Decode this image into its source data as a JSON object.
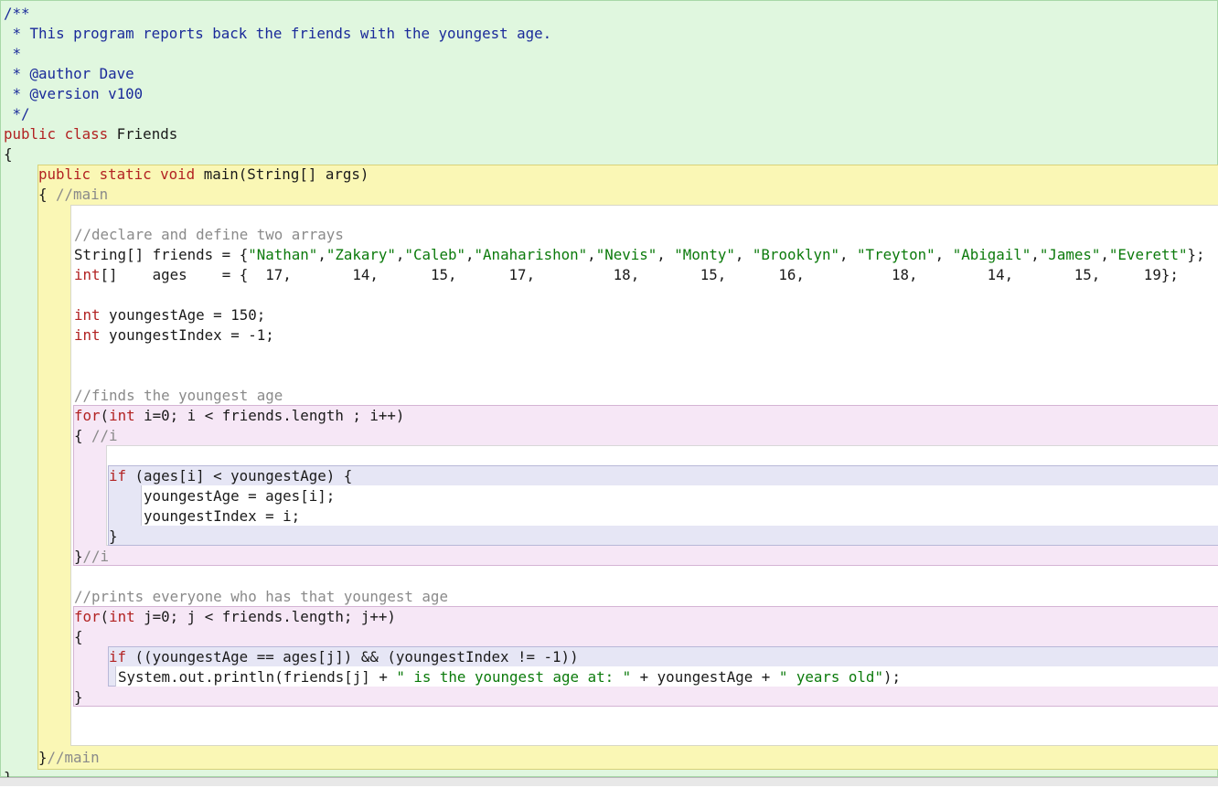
{
  "editor": {
    "lines": [
      {
        "id": "l01",
        "tokens": [
          {
            "t": "/**",
            "c": "jd"
          }
        ]
      },
      {
        "id": "l02",
        "tokens": [
          {
            "t": " * This program reports back the friends with the youngest age.",
            "c": "jd"
          }
        ]
      },
      {
        "id": "l03",
        "tokens": [
          {
            "t": " *",
            "c": "jd"
          }
        ]
      },
      {
        "id": "l04",
        "tokens": [
          {
            "t": " * @author Dave",
            "c": "jd"
          }
        ]
      },
      {
        "id": "l05",
        "tokens": [
          {
            "t": " * @version v100",
            "c": "jd"
          }
        ]
      },
      {
        "id": "l06",
        "tokens": [
          {
            "t": " */",
            "c": "jd"
          }
        ]
      },
      {
        "id": "l07",
        "tokens": [
          {
            "t": "public class",
            "c": "kw"
          },
          {
            "t": " Friends",
            "c": ""
          }
        ]
      },
      {
        "id": "l08",
        "tokens": [
          {
            "t": "{",
            "c": ""
          }
        ]
      },
      {
        "id": "l09",
        "tokens": [
          {
            "t": "public static void",
            "c": "kw"
          },
          {
            "t": " main(String[] args)",
            "c": ""
          }
        ]
      },
      {
        "id": "l10",
        "tokens": [
          {
            "t": "{ ",
            "c": ""
          },
          {
            "t": "//main",
            "c": "cm"
          }
        ]
      },
      {
        "id": "l11",
        "tokens": [
          {
            "t": "//declare and define two arrays",
            "c": "cm"
          }
        ]
      },
      {
        "id": "l12",
        "tokens": [
          {
            "t": "String[] friends = {",
            "c": ""
          },
          {
            "t": "\"Nathan\"",
            "c": "str"
          },
          {
            "t": ",",
            "c": ""
          },
          {
            "t": "\"Zakary\"",
            "c": "str"
          },
          {
            "t": ",",
            "c": ""
          },
          {
            "t": "\"Caleb\"",
            "c": "str"
          },
          {
            "t": ",",
            "c": ""
          },
          {
            "t": "\"Anaharishon\"",
            "c": "str"
          },
          {
            "t": ",",
            "c": ""
          },
          {
            "t": "\"Nevis\"",
            "c": "str"
          },
          {
            "t": ", ",
            "c": ""
          },
          {
            "t": "\"Monty\"",
            "c": "str"
          },
          {
            "t": ", ",
            "c": ""
          },
          {
            "t": "\"Brooklyn\"",
            "c": "str"
          },
          {
            "t": ", ",
            "c": ""
          },
          {
            "t": "\"Treyton\"",
            "c": "str"
          },
          {
            "t": ", ",
            "c": ""
          },
          {
            "t": "\"Abigail\"",
            "c": "str"
          },
          {
            "t": ",",
            "c": ""
          },
          {
            "t": "\"James\"",
            "c": "str"
          },
          {
            "t": ",",
            "c": ""
          },
          {
            "t": "\"Everett\"",
            "c": "str"
          },
          {
            "t": "};",
            "c": ""
          }
        ]
      },
      {
        "id": "l13",
        "tokens": [
          {
            "t": "int",
            "c": "kw"
          },
          {
            "t": "[]    ages    = {  17,       14,      15,      17,         18,       15,      16,          18,        14,       15,     19};",
            "c": ""
          }
        ]
      },
      {
        "id": "l14",
        "tokens": [
          {
            "t": "int",
            "c": "kw"
          },
          {
            "t": " youngestAge = 150;",
            "c": ""
          }
        ]
      },
      {
        "id": "l15",
        "tokens": [
          {
            "t": "int",
            "c": "kw"
          },
          {
            "t": " youngestIndex = -1;",
            "c": ""
          }
        ]
      },
      {
        "id": "l16",
        "tokens": [
          {
            "t": "//finds the youngest age",
            "c": "cm"
          }
        ]
      },
      {
        "id": "l17",
        "tokens": [
          {
            "t": "for",
            "c": "kw"
          },
          {
            "t": "(",
            "c": ""
          },
          {
            "t": "int",
            "c": "kw"
          },
          {
            "t": " i=0; i < friends.length ; i++)",
            "c": ""
          }
        ]
      },
      {
        "id": "l18",
        "tokens": [
          {
            "t": "{ ",
            "c": ""
          },
          {
            "t": "//i",
            "c": "cm"
          }
        ]
      },
      {
        "id": "l19",
        "tokens": [
          {
            "t": "if",
            "c": "kw"
          },
          {
            "t": " (ages[i] < youngestAge) {",
            "c": ""
          }
        ]
      },
      {
        "id": "l20",
        "tokens": [
          {
            "t": "youngestAge = ages[i];",
            "c": ""
          }
        ]
      },
      {
        "id": "l21",
        "tokens": [
          {
            "t": "youngestIndex = i;",
            "c": ""
          }
        ]
      },
      {
        "id": "l22",
        "tokens": [
          {
            "t": "}",
            "c": ""
          }
        ]
      },
      {
        "id": "l23",
        "tokens": [
          {
            "t": "}",
            "c": ""
          },
          {
            "t": "//i",
            "c": "cm"
          }
        ]
      },
      {
        "id": "l24",
        "tokens": [
          {
            "t": "//prints everyone who has that youngest age",
            "c": "cm"
          }
        ]
      },
      {
        "id": "l25",
        "tokens": [
          {
            "t": "for",
            "c": "kw"
          },
          {
            "t": "(",
            "c": ""
          },
          {
            "t": "int",
            "c": "kw"
          },
          {
            "t": " j=0; j < friends.length; j++)",
            "c": ""
          }
        ]
      },
      {
        "id": "l26",
        "tokens": [
          {
            "t": "{",
            "c": ""
          }
        ]
      },
      {
        "id": "l27",
        "tokens": [
          {
            "t": "if",
            "c": "kw"
          },
          {
            "t": " ((youngestAge == ages[j]) && (youngestIndex != -1))",
            "c": ""
          }
        ]
      },
      {
        "id": "l28",
        "tokens": [
          {
            "t": "System.out.println(friends[j] + ",
            "c": ""
          },
          {
            "t": "\" is the youngest age at: \"",
            "c": "str"
          },
          {
            "t": " + youngestAge + ",
            "c": ""
          },
          {
            "t": "\" years old\"",
            "c": "str"
          },
          {
            "t": ");",
            "c": ""
          }
        ]
      },
      {
        "id": "l29",
        "tokens": [
          {
            "t": "}",
            "c": ""
          }
        ]
      },
      {
        "id": "l30",
        "tokens": [
          {
            "t": "}",
            "c": ""
          },
          {
            "t": "//main",
            "c": "cm"
          }
        ]
      },
      {
        "id": "l31",
        "tokens": [
          {
            "t": "}",
            "c": ""
          }
        ]
      }
    ]
  },
  "colors": {
    "class_scope": "#e0f7df",
    "method_scope": "#faf7b5",
    "method_body": "#ffffff",
    "loop_scope": "#f6e7f6",
    "if_scope": "#e6e6f5",
    "keyword": "#b22222",
    "string": "#0b7a0b",
    "comment": "#8a8a8a",
    "javadoc": "#1a2a9a"
  }
}
